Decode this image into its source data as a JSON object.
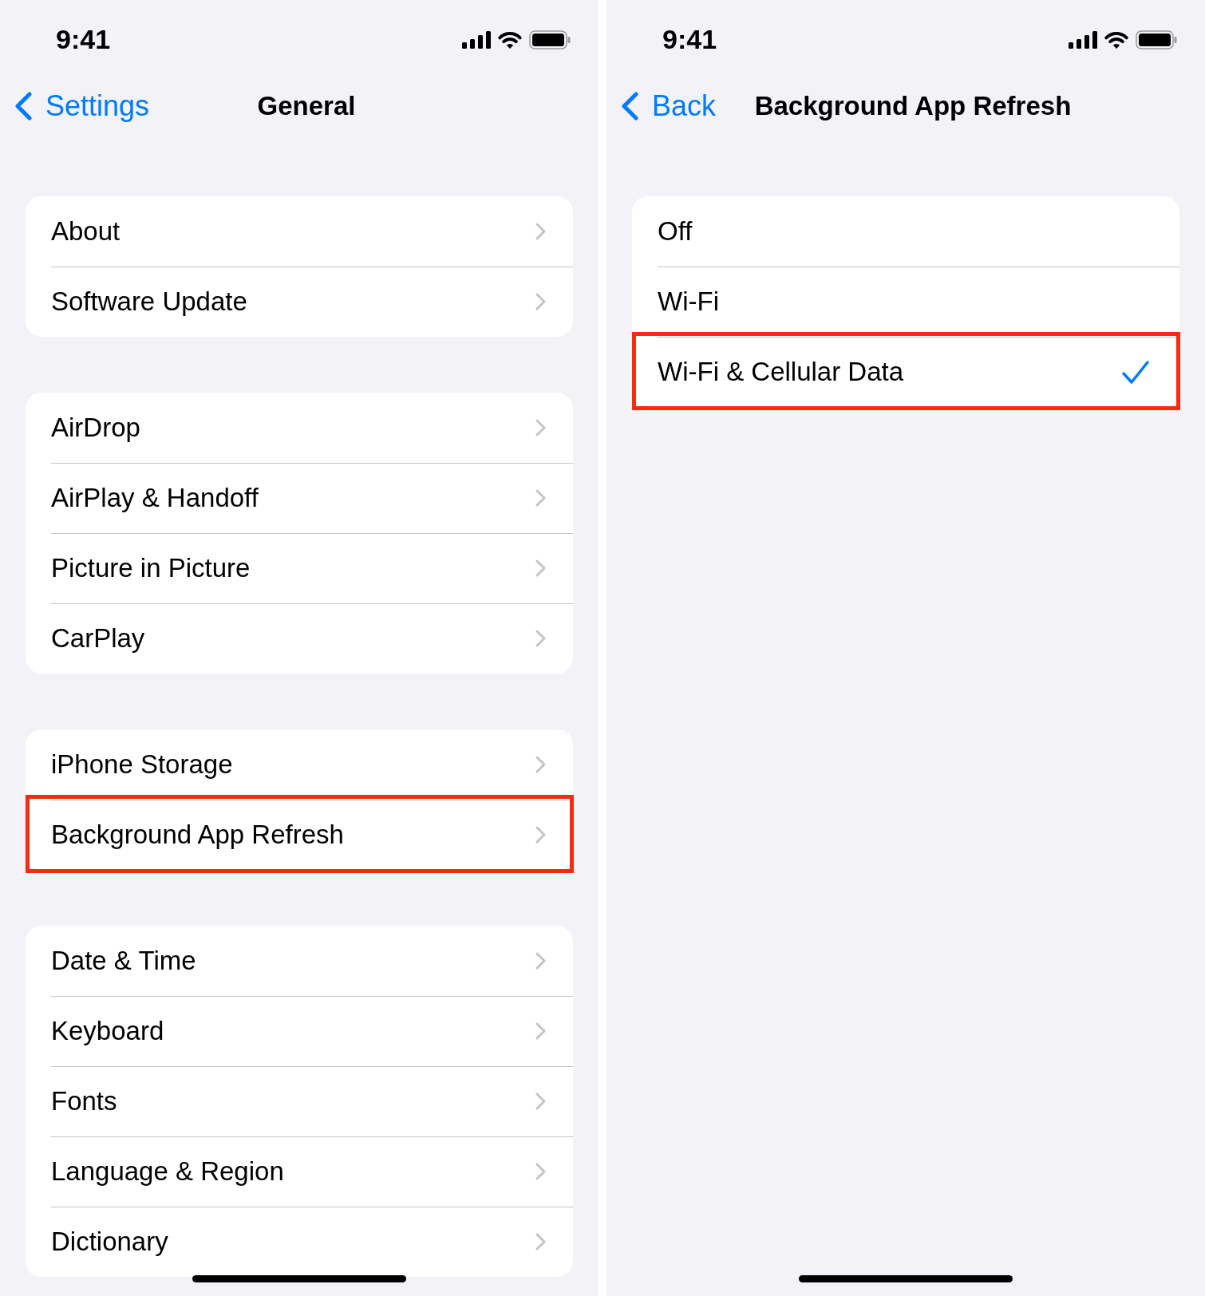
{
  "screens": [
    {
      "status_bar": {
        "time": "9:41"
      },
      "nav_bar": {
        "back_label": "Settings",
        "title": "General"
      },
      "groups": [
        {
          "items": [
            {
              "label": "About",
              "kind": "link",
              "highlighted": false
            },
            {
              "label": "Software Update",
              "kind": "link",
              "highlighted": false
            }
          ]
        },
        {
          "items": [
            {
              "label": "AirDrop",
              "kind": "link",
              "highlighted": false
            },
            {
              "label": "AirPlay & Handoff",
              "kind": "link",
              "highlighted": false
            },
            {
              "label": "Picture in Picture",
              "kind": "link",
              "highlighted": false
            },
            {
              "label": "CarPlay",
              "kind": "link",
              "highlighted": false
            }
          ]
        },
        {
          "items": [
            {
              "label": "iPhone Storage",
              "kind": "link",
              "highlighted": false
            },
            {
              "label": "Background App Refresh",
              "kind": "link",
              "highlighted": true
            }
          ]
        },
        {
          "items": [
            {
              "label": "Date & Time",
              "kind": "link",
              "highlighted": false
            },
            {
              "label": "Keyboard",
              "kind": "link",
              "highlighted": false
            },
            {
              "label": "Fonts",
              "kind": "link",
              "highlighted": false
            },
            {
              "label": "Language & Region",
              "kind": "link",
              "highlighted": false
            },
            {
              "label": "Dictionary",
              "kind": "link",
              "highlighted": false
            }
          ]
        }
      ]
    },
    {
      "status_bar": {
        "time": "9:41"
      },
      "nav_bar": {
        "back_label": "Back",
        "title": "Background App Refresh"
      },
      "groups": [
        {
          "items": [
            {
              "label": "Off",
              "kind": "option",
              "selected": false,
              "highlighted": false
            },
            {
              "label": "Wi-Fi",
              "kind": "option",
              "selected": false,
              "highlighted": false
            },
            {
              "label": "Wi-Fi & Cellular Data",
              "kind": "option",
              "selected": true,
              "highlighted": true
            }
          ]
        }
      ]
    }
  ]
}
